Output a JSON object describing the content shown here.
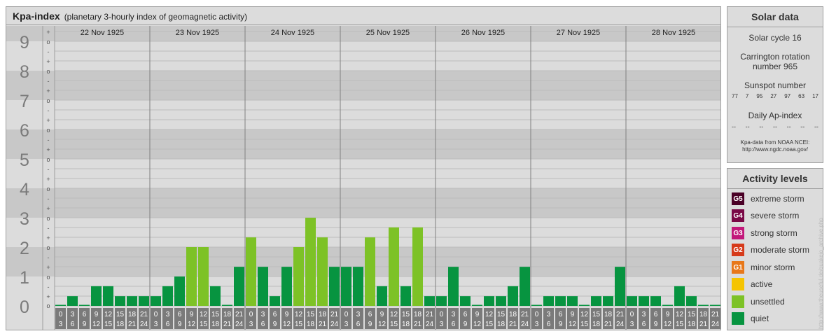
{
  "header": {
    "title": "Kpa-index",
    "subtitle": "(planetary 3-hourly index of geomagnetic activity)"
  },
  "solar": {
    "title": "Solar data",
    "cycle": "Solar cycle 16",
    "carrington_line1": "Carrington rotation",
    "carrington_line2": "number 965",
    "sunspot_label": "Sunspot number",
    "sunspot_values": [
      "77",
      "7",
      "95",
      "27",
      "97",
      "63",
      "17"
    ],
    "ap_label": "Daily Ap-index",
    "ap_values": [
      "--",
      "--",
      "--",
      "--",
      "--",
      "--",
      "--"
    ],
    "source_line1": "Kpa-data from NOAA NCEI:",
    "source_line2": "http://www.ngdc.noaa.gov/"
  },
  "levels": {
    "title": "Activity levels",
    "items": [
      {
        "badge": "G5",
        "label": "extreme storm",
        "color": "#4a0026"
      },
      {
        "badge": "G4",
        "label": "severe storm",
        "color": "#7a0846"
      },
      {
        "badge": "G3",
        "label": "strong storm",
        "color": "#c2187a"
      },
      {
        "badge": "G2",
        "label": "moderate storm",
        "color": "#d63a1a"
      },
      {
        "badge": "G1",
        "label": "minor storm",
        "color": "#e8781a"
      },
      {
        "badge": "",
        "label": "active",
        "color": "#f5c400"
      },
      {
        "badge": "",
        "label": "unsettled",
        "color": "#7dc226"
      },
      {
        "badge": "",
        "label": "quiet",
        "color": "#079440"
      }
    ]
  },
  "credit": "http://www.theuseful.de/quakejo_archive.php",
  "chart_data": {
    "type": "bar",
    "days": [
      "22 Nov 1925",
      "23 Nov 1925",
      "24 Nov 1925",
      "25 Nov 1925",
      "26 Nov 1925",
      "27 Nov 1925",
      "28 Nov 1925"
    ],
    "hour_labels_top": [
      "0",
      "3",
      "6",
      "9",
      "12",
      "15",
      "18",
      "21"
    ],
    "hour_labels_bottom": [
      "3",
      "6",
      "9",
      "12",
      "15",
      "18",
      "21",
      "24"
    ],
    "y_ticks": [
      "0",
      "1",
      "2",
      "3",
      "4",
      "5",
      "6",
      "7",
      "8",
      "9"
    ],
    "sub_ticks": [
      "+",
      "o",
      "-"
    ],
    "sub_tick_bottom": "o",
    "ylim": [
      0,
      9.33
    ],
    "values": [
      0,
      0.33,
      0,
      0.67,
      0.67,
      0.33,
      0.33,
      0.33,
      0.33,
      0.67,
      1,
      2,
      2,
      0.67,
      0,
      1.33,
      2.33,
      1.33,
      0.33,
      1.33,
      2,
      3,
      2.33,
      1.33,
      1.33,
      1.33,
      2.33,
      0.67,
      2.67,
      0.67,
      2.67,
      0.33,
      0.33,
      1.33,
      0.33,
      0,
      0.33,
      0.33,
      0.67,
      1.33,
      0,
      0.33,
      0.33,
      0.33,
      0,
      0.33,
      0.33,
      1.33,
      0.33,
      0.33,
      0.33,
      0,
      0.67,
      0.33,
      0,
      0
    ],
    "colors": {
      "quiet": "#079440",
      "unsettled": "#7dc226",
      "active": "#f5c400",
      "minor": "#e8781a"
    }
  }
}
